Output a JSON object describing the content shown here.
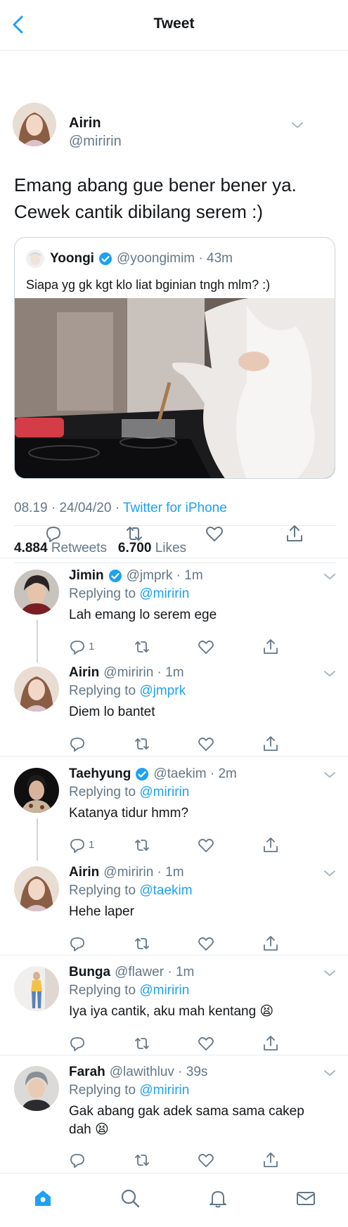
{
  "header": {
    "title": "Tweet",
    "back_icon": "chevron-left-icon"
  },
  "colors": {
    "accent": "#1da1f2",
    "secondary_text": "#657786",
    "border": "#e6ecf0"
  },
  "tweet": {
    "author_name": "Airin",
    "author_handle": "@miririn",
    "text_line1": "Emang abang gue bener bener ya.",
    "text_line2": "Cewek cantik dibilang serem :)",
    "quote": {
      "name": "Yoongi",
      "handle": "@yoongimim",
      "time": "43m",
      "text": "Siapa yg gk kgt klo liat bginian tngh mlm? :)"
    },
    "time": "08.19",
    "date": "24/04/20",
    "client": "Twitter for iPhone",
    "retweets": "4.884",
    "retweets_label": "Retweets",
    "likes": "6.700",
    "likes_label": "Likes"
  },
  "replies": [
    {
      "name": "Jimin",
      "verified": true,
      "handle": "@jmprk",
      "time": "1m",
      "replying_prefix": "Replying to",
      "replying_to": "@miririn",
      "text": "Lah emang lo serem ege",
      "reply_count": "1"
    },
    {
      "name": "Airin",
      "verified": false,
      "handle": "@miririn",
      "time": "1m",
      "replying_prefix": "Replying to",
      "replying_to": "@jmprk",
      "text": "Diem lo bantet",
      "reply_count": ""
    },
    {
      "name": "Taehyung",
      "verified": true,
      "handle": "@taekim",
      "time": "2m",
      "replying_prefix": "Replying to",
      "replying_to": "@miririn",
      "text": "Katanya tidur hmm?",
      "reply_count": "1"
    },
    {
      "name": "Airin",
      "verified": false,
      "handle": "@miririn",
      "time": "1m",
      "replying_prefix": "Replying to",
      "replying_to": "@taekim",
      "text": "Hehe laper",
      "reply_count": ""
    },
    {
      "name": "Bunga",
      "verified": false,
      "handle": "@flawer",
      "time": "1m",
      "replying_prefix": "Replying to",
      "replying_to": "@miririn",
      "text": "Iya iya cantik, aku mah kentang 😫",
      "reply_count": ""
    },
    {
      "name": "Farah",
      "verified": false,
      "handle": "@lawithluv",
      "time": "39s",
      "replying_prefix": "Replying to",
      "replying_to": "@miririn",
      "text": "Gak abang gak adek sama sama cakep dah 😫",
      "reply_count": ""
    }
  ],
  "nav": [
    "home-icon",
    "search-icon",
    "notifications-icon",
    "messages-icon"
  ]
}
